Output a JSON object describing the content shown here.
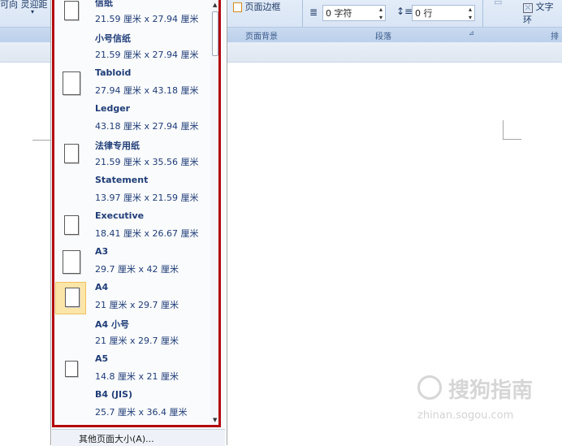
{
  "ribbon": {
    "left_fragment": "可向 灵迎距",
    "page_border_label": "页面边框",
    "indent_value": "0 字符",
    "spacing_value": "0 行",
    "text_wrap_label": "文字环",
    "groups": {
      "page_background": "页面背景",
      "paragraph": "段落",
      "arrange": "排"
    }
  },
  "paper_sizes": [
    {
      "name": "信纸",
      "dims": "21.59 厘米 x 27.94 厘米",
      "icon": "portrait"
    },
    {
      "name": "小号信纸",
      "dims": "21.59 厘米 x 27.94 厘米",
      "icon": "none"
    },
    {
      "name": "Tabloid",
      "dims": "27.94 厘米 x 43.18 厘米",
      "icon": "portrait-large"
    },
    {
      "name": "Ledger",
      "dims": "43.18 厘米 x 27.94 厘米",
      "icon": "none"
    },
    {
      "name": "法律专用纸",
      "dims": "21.59 厘米 x 35.56 厘米",
      "icon": "portrait"
    },
    {
      "name": "Statement",
      "dims": "13.97 厘米 x 21.59 厘米",
      "icon": "none"
    },
    {
      "name": "Executive",
      "dims": "18.41 厘米 x 26.67 厘米",
      "icon": "portrait"
    },
    {
      "name": "A3",
      "dims": "29.7 厘米 x 42 厘米",
      "icon": "portrait-large"
    },
    {
      "name": "A4",
      "dims": "21 厘米 x 29.7 厘米",
      "icon": "portrait",
      "selected": true
    },
    {
      "name": "A4 小号",
      "dims": "21 厘米 x 29.7 厘米",
      "icon": "none"
    },
    {
      "name": "A5",
      "dims": "14.8 厘米 x 21 厘米",
      "icon": "portrait-small"
    },
    {
      "name": "B4 (JIS)",
      "dims": "25.7 厘米 x 36.4 厘米",
      "icon": "none"
    }
  ],
  "more_sizes_label": "其他页面大小(A)...",
  "watermark": {
    "text": "搜狗指南",
    "url": "zhinan.sogou.com"
  },
  "colors": {
    "highlight_frame": "#b2080d",
    "item_text": "#1f3d77",
    "selected_fill": "#fbe5a8"
  }
}
